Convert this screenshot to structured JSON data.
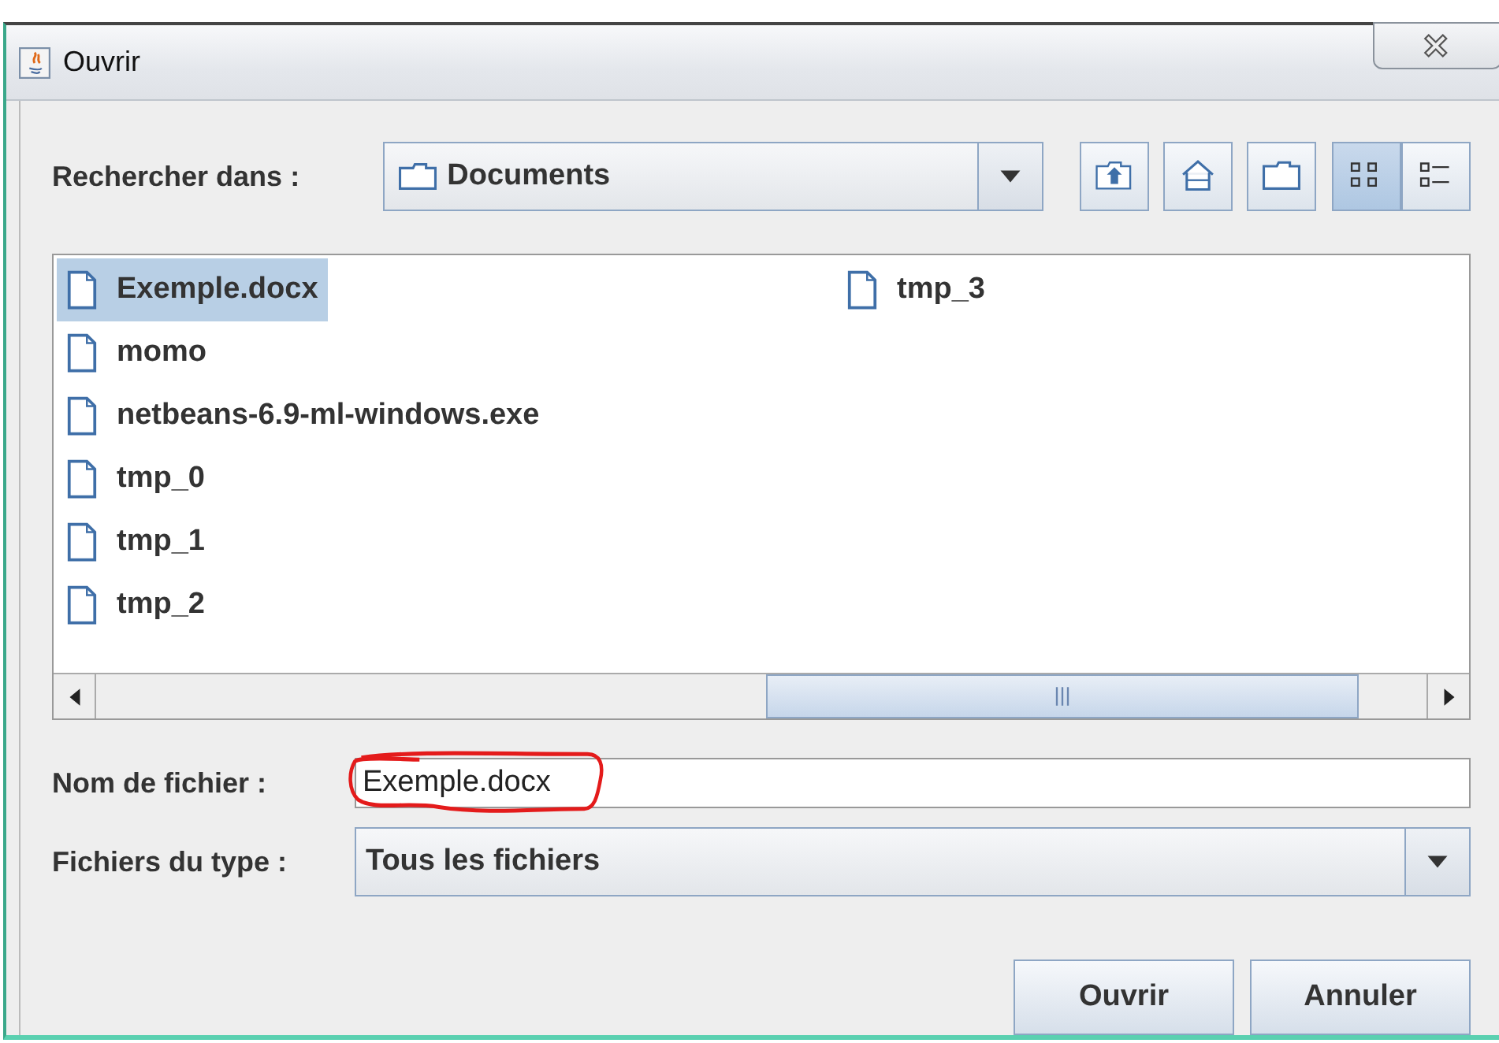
{
  "window": {
    "title": "Ouvrir"
  },
  "look_in": {
    "label": "Rechercher dans :",
    "value": "Documents"
  },
  "toolbar": [
    {
      "kind": "up",
      "selected": false
    },
    {
      "kind": "home",
      "selected": false
    },
    {
      "kind": "newfolder",
      "selected": false
    },
    {
      "kind": "list",
      "selected": true
    },
    {
      "kind": "details",
      "selected": false
    }
  ],
  "files": [
    {
      "name": "Exemple.docx",
      "selected": true
    },
    {
      "name": "momo",
      "selected": false
    },
    {
      "name": "netbeans-6.9-ml-windows.exe",
      "selected": false
    },
    {
      "name": "tmp_0",
      "selected": false
    },
    {
      "name": "tmp_1",
      "selected": false
    },
    {
      "name": "tmp_2",
      "selected": false
    },
    {
      "name": "tmp_3",
      "selected": false
    }
  ],
  "file_name": {
    "label": "Nom de fichier :",
    "value": "Exemple.docx",
    "circled": true
  },
  "file_type": {
    "label": "Fichiers du type :",
    "value": "Tous les fichiers"
  },
  "buttons": [
    "Ouvrir",
    "Annuler"
  ]
}
